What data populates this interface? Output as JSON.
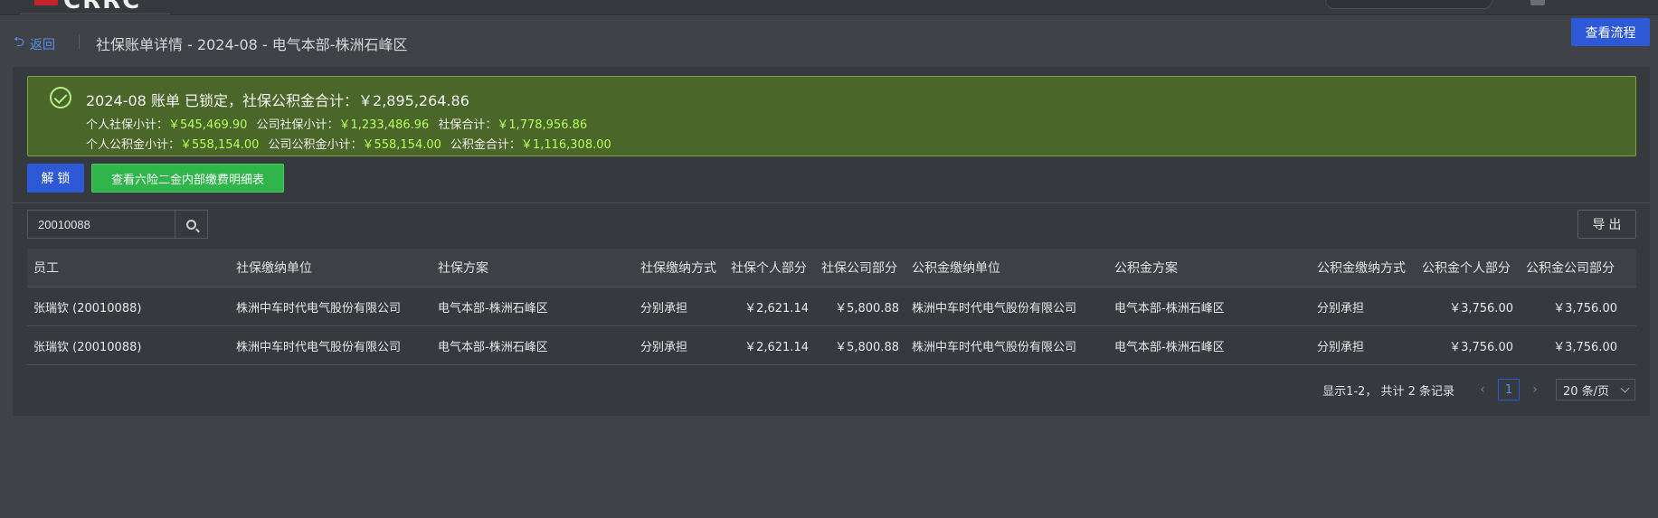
{
  "topbar": {
    "logo_text": "CRRC"
  },
  "header": {
    "back_label": "返回",
    "back_icon": "undo-arrow-icon",
    "title": "社保账单详情 - 2024-08 - 电气本部-株洲石峰区",
    "view_flow_label": "查看流程"
  },
  "alert": {
    "main": "2024-08 账单 已锁定，社保公积金合计：￥2,895,264.86",
    "row1": [
      {
        "label": "个人社保小计：",
        "value": "￥545,469.90"
      },
      {
        "label": "公司社保小计：",
        "value": "￥1,233,486.96"
      },
      {
        "label": "社保合计：",
        "value": "￥1,778,956.86"
      }
    ],
    "row2": [
      {
        "label": "个人公积金小计：",
        "value": "￥558,154.00"
      },
      {
        "label": "公司公积金小计：",
        "value": "￥558,154.00"
      },
      {
        "label": "公积金合计：",
        "value": "￥1,116,308.00"
      }
    ]
  },
  "actions": {
    "unlock_label": "解 锁",
    "detail_label": "查看六险二金内部缴费明细表"
  },
  "search": {
    "value": "20010088",
    "export_label": "导 出"
  },
  "table": {
    "headers": [
      "员工",
      "社保缴纳单位",
      "社保方案",
      "社保缴纳方式",
      "社保个人部分",
      "社保公司部分",
      "公积金缴纳单位",
      "公积金方案",
      "公积金缴纳方式",
      "公积金个人部分",
      "公积金公司部分"
    ],
    "rows": [
      [
        "张瑞钦 (20010088)",
        "株洲中车时代电气股份有限公司",
        "电气本部-株洲石峰区",
        "分别承担",
        "￥2,621.14",
        "￥5,800.88",
        "株洲中车时代电气股份有限公司",
        "电气本部-株洲石峰区",
        "分别承担",
        "￥3,756.00",
        "￥3,756.00"
      ],
      [
        "张瑞钦 (20010088)",
        "株洲中车时代电气股份有限公司",
        "电气本部-株洲石峰区",
        "分别承担",
        "￥2,621.14",
        "￥5,800.88",
        "株洲中车时代电气股份有限公司",
        "电气本部-株洲石峰区",
        "分别承担",
        "￥3,756.00",
        "￥3,756.00"
      ]
    ]
  },
  "pagination": {
    "summary": "显示1-2， 共计 2 条记录",
    "current_page": "1",
    "page_size": "20 条/页"
  },
  "colors": {
    "accent": "#2d58d6",
    "success": "#2fb54a",
    "alert_bg": "#4a6628",
    "alert_value": "#b6ff5a",
    "link": "#5b8fe8"
  }
}
